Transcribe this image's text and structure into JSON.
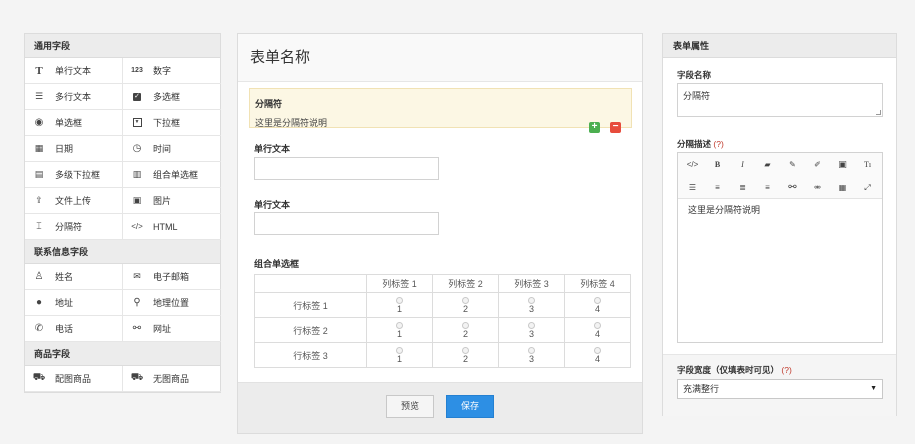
{
  "palette": {
    "sections": [
      {
        "title": "通用字段",
        "items": [
          {
            "icon": "text-icon",
            "label": "单行文本"
          },
          {
            "icon": "number-icon",
            "label": "数字"
          },
          {
            "icon": "paragraph-icon",
            "label": "多行文本"
          },
          {
            "icon": "checkbox-icon",
            "label": "多选框"
          },
          {
            "icon": "radio-icon",
            "label": "单选框"
          },
          {
            "icon": "dropdown-icon",
            "label": "下拉框"
          },
          {
            "icon": "calendar-icon",
            "label": "日期"
          },
          {
            "icon": "clock-icon",
            "label": "时间"
          },
          {
            "icon": "cascade-icon",
            "label": "多级下拉框"
          },
          {
            "icon": "radio-group-icon",
            "label": "组合单选框"
          },
          {
            "icon": "upload-icon",
            "label": "文件上传"
          },
          {
            "icon": "image-icon",
            "label": "图片"
          },
          {
            "icon": "separator-icon",
            "label": "分隔符"
          },
          {
            "icon": "code-icon",
            "label": "HTML"
          }
        ]
      },
      {
        "title": "联系信息字段",
        "items": [
          {
            "icon": "user-icon",
            "label": "姓名"
          },
          {
            "icon": "email-icon",
            "label": "电子邮箱"
          },
          {
            "icon": "globe-icon",
            "label": "地址"
          },
          {
            "icon": "map-pin-icon",
            "label": "地理位置"
          },
          {
            "icon": "phone-icon",
            "label": "电话"
          },
          {
            "icon": "link-icon",
            "label": "网址"
          }
        ]
      },
      {
        "title": "商品字段",
        "items": [
          {
            "icon": "cart-icon",
            "label": "配图商品"
          },
          {
            "icon": "cart-outline-icon",
            "label": "无图商品"
          }
        ]
      }
    ]
  },
  "form": {
    "title": "表单名称",
    "separator": {
      "title": "分隔符",
      "description": "这里是分隔符说明"
    },
    "field1_label": "单行文本",
    "field2_label": "单行文本",
    "matrix": {
      "label": "组合单选框",
      "columns": [
        "列标签 1",
        "列标签 2",
        "列标签 3",
        "列标签 4"
      ],
      "rows": [
        "行标签 1",
        "行标签 2",
        "行标签 3"
      ],
      "option_values": [
        "1",
        "2",
        "3",
        "4"
      ]
    },
    "preview_label": "预览",
    "save_label": "保存"
  },
  "props": {
    "title": "表单属性",
    "field_name_label": "字段名称",
    "field_name_value": "分隔符",
    "desc_label": "分隔描述",
    "help": "(?)",
    "editor_toolbar": [
      "code-icon",
      "bold-icon",
      "italic-icon",
      "eraser-icon",
      "pencil-icon",
      "brush-icon",
      "image-icon",
      "text-size-icon",
      "list-icon",
      "align-left-icon",
      "align-center-icon",
      "align-right-icon",
      "link-icon",
      "unlink-icon",
      "table-icon",
      "fullscreen-icon"
    ],
    "editor_content": "这里是分隔符说明",
    "width_label": "字段宽度（仅填表时可见）",
    "width_value": "充满整行"
  }
}
